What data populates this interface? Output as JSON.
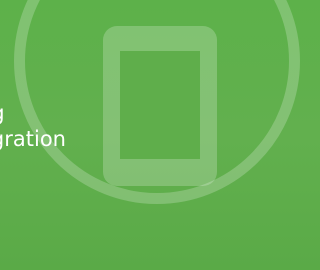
{
  "banner": {
    "headline_line_1": "ng",
    "headline_line_2": "egration",
    "background_color": "#5fae4b",
    "graphic_icon": "mobile-phone-icon"
  }
}
